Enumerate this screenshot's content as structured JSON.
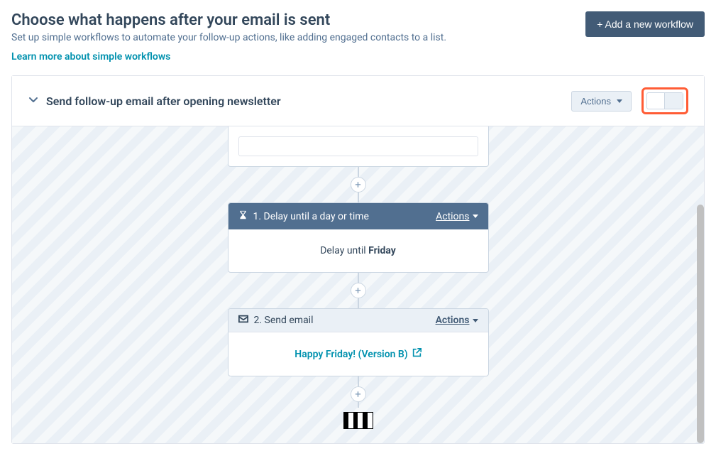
{
  "header": {
    "title": "Choose what happens after your email is sent",
    "subtitle": "Set up simple workflows to automate your follow-up actions, like adding engaged contacts to a list.",
    "learn_more": "Learn more about simple workflows",
    "add_button": "+ Add a new workflow"
  },
  "workflow": {
    "title": "Send follow-up email after opening newsletter",
    "actions_label": "Actions"
  },
  "steps": {
    "delay": {
      "label": "1. Delay until a day or time",
      "actions": "Actions",
      "body_prefix": "Delay until ",
      "body_value": "Friday"
    },
    "send": {
      "label": "2. Send email",
      "actions": "Actions",
      "email_name": "Happy Friday! (Version B)"
    }
  },
  "icons": {
    "plus": "+",
    "external_link_title": "Open"
  }
}
